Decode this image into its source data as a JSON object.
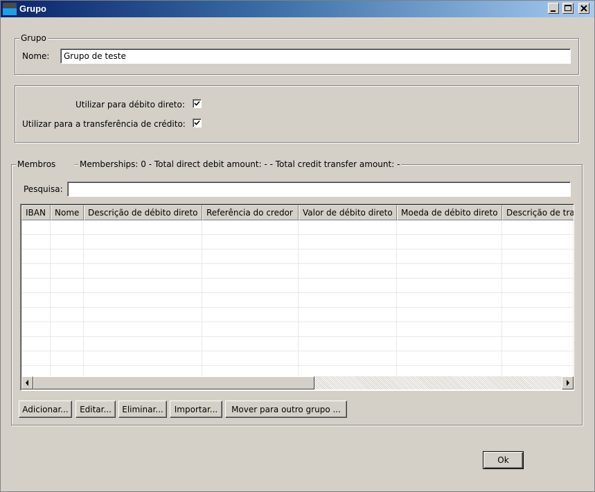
{
  "window": {
    "title": "Grupo",
    "icon": "app-window-icon"
  },
  "title_buttons": {
    "minimize": "minimize-icon",
    "maximize": "maximize-icon",
    "close": "close-icon"
  },
  "group_section": {
    "legend": "Grupo",
    "name_label": "Nome:",
    "name_value": "Grupo de teste"
  },
  "usage": {
    "direct_debit_label": "Utilizar para débito direto:",
    "direct_debit_checked": true,
    "credit_transfer_label": "Utilizar para a transferência de crédito:",
    "credit_transfer_checked": true
  },
  "members": {
    "legend": "Membros",
    "summary": "Memberships: 0 - Total direct debit amount: - - Total credit transfer amount: -",
    "search_label": "Pesquisa:",
    "search_value": "",
    "columns": [
      "IBAN",
      "Nome",
      "Descrição de débito direto",
      "Referência do credor",
      "Valor de débito direto",
      "Moeda de débito direto",
      "Descrição de tra"
    ],
    "rows": [],
    "buttons": {
      "add": "Adicionar...",
      "edit": "Editar...",
      "delete": "Eliminar...",
      "import": "Importar...",
      "move": "Mover para outro grupo ..."
    }
  },
  "ok_label": "Ok"
}
